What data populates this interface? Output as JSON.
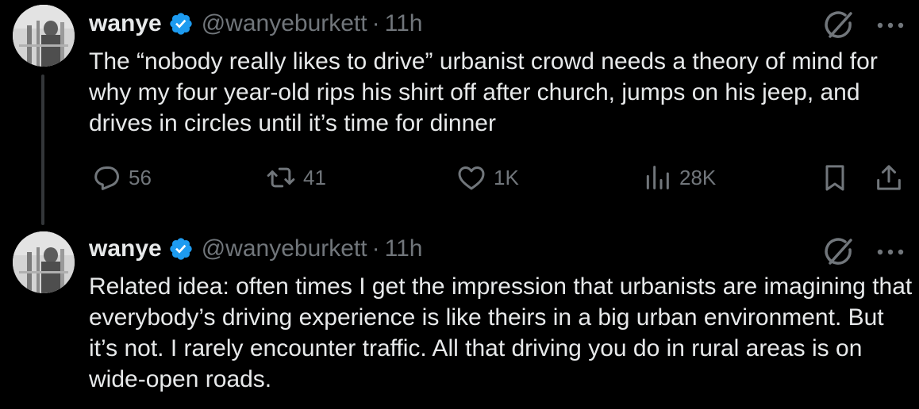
{
  "tweets": [
    {
      "author": {
        "name": "wanye",
        "handle": "@wanyeburkett",
        "verified": true
      },
      "separator": "·",
      "time": "11h",
      "text": "The “nobody really likes to drive” urbanist crowd needs a theory of mind for why my four year-old rips his shirt off after church, jumps on his jeep, and drives in circles until it’s time for dinner",
      "metrics": {
        "replies": "56",
        "reposts": "41",
        "likes": "1K",
        "views": "28K"
      }
    },
    {
      "author": {
        "name": "wanye",
        "handle": "@wanyeburkett",
        "verified": true
      },
      "separator": "·",
      "time": "11h",
      "text": "Related idea: often times I get the impression that urbanists are imagining that everybody’s driving experience is like theirs in a big urban environment. But it’s not. I rarely encounter traffic. All that driving you do in rural areas is on wide-open roads."
    }
  ],
  "icons": {
    "verified": "verified-badge-icon",
    "grok": "grok-icon",
    "more": "more-dots-icon",
    "reply": "reply-icon",
    "repost": "repost-icon",
    "like": "heart-icon",
    "views": "views-chart-icon",
    "bookmark": "bookmark-icon",
    "share": "share-icon"
  },
  "colors": {
    "background": "#000000",
    "text": "#e7e9ea",
    "muted": "#71767b",
    "verified": "#1d9bf0",
    "thread_line": "#333639"
  }
}
